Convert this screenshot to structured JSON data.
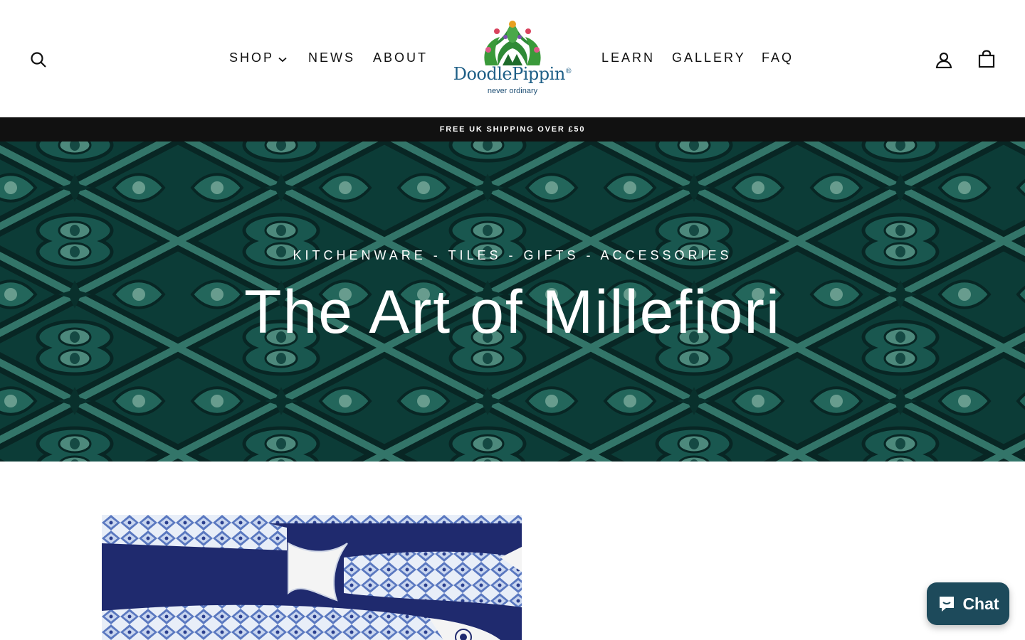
{
  "header": {
    "nav_left": [
      {
        "label": "SHOP",
        "has_dropdown": true
      },
      {
        "label": "NEWS"
      },
      {
        "label": "ABOUT"
      }
    ],
    "nav_right": [
      {
        "label": "LEARN"
      },
      {
        "label": "GALLERY"
      },
      {
        "label": "FAQ"
      }
    ],
    "logo": {
      "name": "DoodlePippin",
      "registered": "®",
      "tagline": "never ordinary"
    },
    "icons": {
      "search": "search-icon",
      "account": "account-icon",
      "cart": "cart-icon"
    }
  },
  "announcement": {
    "text": "FREE UK SHIPPING OVER £50"
  },
  "hero": {
    "subtitle": "KITCHENWARE - TILES - GIFTS - ACCESSORIES",
    "title": "The Art of Millefiori"
  },
  "chat": {
    "label": "Chat",
    "icon": "chat-bubble-icon"
  },
  "colors": {
    "hero_teal": "#0f4a44",
    "announcement_bg": "#111111",
    "chat_bg": "#1d4a5b",
    "logo_blue": "#1e5f87",
    "product_navy": "#1f2a6e"
  }
}
